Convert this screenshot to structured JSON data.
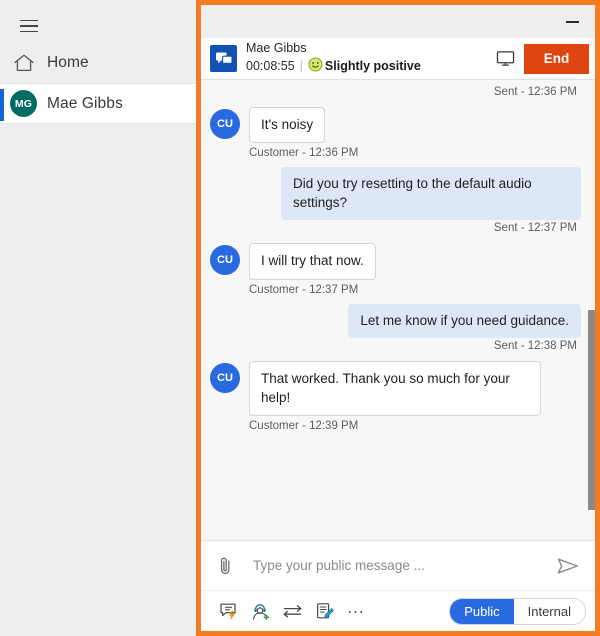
{
  "sidebar": {
    "menu_icon": "hamburger-icon",
    "items": [
      {
        "label": "Home",
        "icon": "home-icon"
      },
      {
        "label": "Mae Gibbs",
        "icon": "avatar",
        "initials": "MG",
        "selected": true
      }
    ]
  },
  "panel": {
    "minimize_label": "minimize-icon"
  },
  "conversation": {
    "channel_icon": "chat-bubbles-icon",
    "customer_name": "Mae Gibbs",
    "timer": "00:08:55",
    "divider": "|",
    "sentiment_label": "Slightly positive",
    "sentiment_icon": "smiley-face-icon",
    "monitor_icon": "monitor-icon",
    "end_button": "End"
  },
  "transcript": {
    "entries": [
      {
        "kind": "status",
        "text": "Sent - 12:36 PM"
      },
      {
        "kind": "incoming",
        "initials": "CU",
        "text": "It's noisy",
        "meta": "Customer - 12:36 PM"
      },
      {
        "kind": "outgoing",
        "text": "Did you try resetting to the default audio settings?",
        "status": "Sent - 12:37 PM"
      },
      {
        "kind": "incoming",
        "initials": "CU",
        "text": "I will try that now.",
        "meta": "Customer - 12:37 PM"
      },
      {
        "kind": "outgoing",
        "text": "Let me know if you need guidance.",
        "status": "Sent - 12:38 PM"
      },
      {
        "kind": "incoming",
        "initials": "CU",
        "text": "That worked. Thank you so much for your help!",
        "meta": "Customer - 12:39 PM"
      }
    ]
  },
  "composer": {
    "attach_icon": "paperclip-icon",
    "placeholder": "Type your public message ...",
    "input_value": "",
    "send_icon": "send-icon",
    "tools": [
      {
        "name": "quick-reply-icon"
      },
      {
        "name": "add-agent-icon"
      },
      {
        "name": "transfer-icon"
      },
      {
        "name": "note-icon"
      }
    ],
    "more_label": "...",
    "visibility": {
      "public_label": "Public",
      "internal_label": "Internal",
      "selected": "Public"
    }
  },
  "colors": {
    "focus_ring": "#f57c20",
    "accent_blue": "#2a6ae0",
    "end_red": "#df4511",
    "avatar_teal": "#046b63",
    "channel_blue": "#1351b4",
    "bubble_out": "#dde7f7"
  }
}
